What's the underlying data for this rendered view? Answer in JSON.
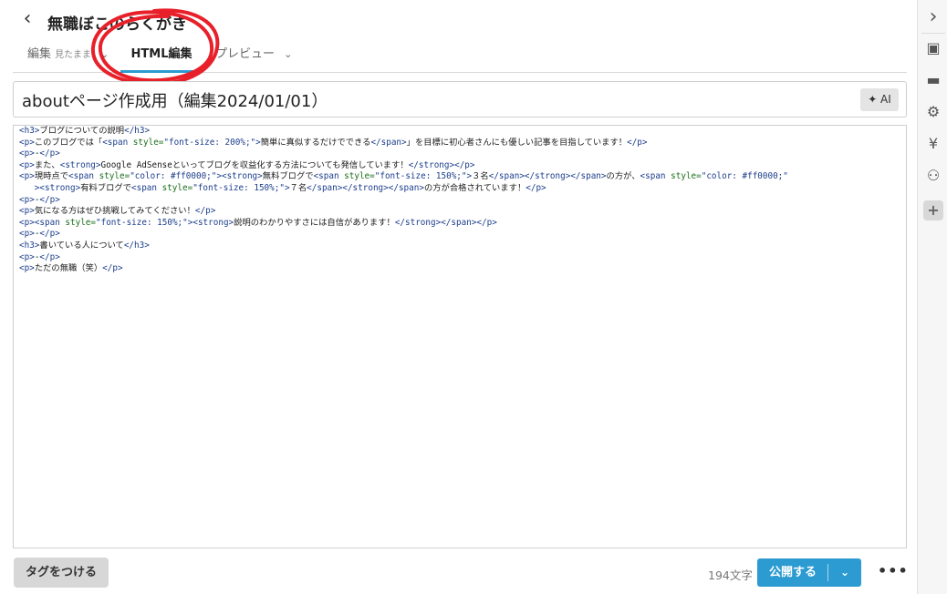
{
  "header": {
    "back_icon": "chevron-left-icon",
    "back_glyph": "‹",
    "blog_title": "無職ぼこのらくがき"
  },
  "tabs": {
    "edit_label": "編集",
    "edit_sub": "見たまま",
    "edit_chevron": "⌄",
    "html_label": "HTML編集",
    "preview_label": "プレビュー",
    "preview_chevron": "⌄",
    "active": "html"
  },
  "entry": {
    "title": "aboutページ作成用（編集2024/01/01）",
    "ai_label": "✦ AI"
  },
  "code_lines": [
    "<h3>ブログについての説明</h3>",
    "<p>このブログでは「<span style=\"font-size: 200%;\">簡単に真似するだけでできる</span>」を目標に初心者さんにも優しい記事を目指しています！</p>",
    "<p>-</p>",
    "<p>また、<strong>Google AdSenseといってブログを収益化する方法についても発信しています！</strong></p>",
    "<p>現時点で<span style=\"color: #ff0000;\"><strong>無料ブログで<span style=\"font-size: 150%;\">３名</span></strong></span>の方が、<span style=\"color: #ff0000;\"",
    "   ><strong>有料ブログで<span style=\"font-size: 150%;\">７名</span></strong></span>の方が合格されています！</p>",
    "<p>-</p>",
    "<p>気になる方はぜひ挑戦してみてください！</p>",
    "<p><span style=\"font-size: 150%;\"><strong>説明のわかりやすさには自信があります！</strong></span></p>",
    "<p>-</p>",
    "<h3>書いている人について</h3>",
    "<p>-</p>",
    "<p>ただの無職（笑）</p>"
  ],
  "footer": {
    "tag_button": "タグをつける",
    "char_count": "194文字",
    "publish_label": "公開する",
    "publish_dropdown_glyph": "⌄",
    "more_glyph": "•••"
  },
  "sidebar": {
    "icons": [
      "chevron-right-icon",
      "image-icon",
      "folder-icon",
      "gear-icon",
      "yen-icon",
      "users-icon",
      "plus-icon"
    ],
    "glyphs": [
      "›",
      "▣",
      "▬",
      "⚙",
      "¥",
      "⚇",
      "+"
    ]
  },
  "colors": {
    "accent": "#2b9bd1",
    "annotation": "#e8202a",
    "tag_color": "#1c3e8c",
    "attr_color": "#1c6e1c",
    "string_color": "#1c3e8c"
  }
}
